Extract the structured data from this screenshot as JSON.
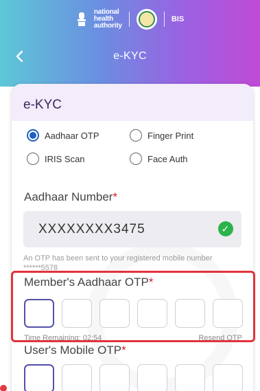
{
  "brand": {
    "nha_line1": "national",
    "nha_line2": "health",
    "nha_line3": "authority",
    "partner": "BIS"
  },
  "titlebar": {
    "title": "e-KYC",
    "back_icon": "chevron-left-icon"
  },
  "card": {
    "heading": "e-KYC",
    "options": [
      {
        "label": "Aadhaar OTP",
        "selected": true
      },
      {
        "label": "Finger Print",
        "selected": false
      },
      {
        "label": "IRIS Scan",
        "selected": false
      },
      {
        "label": "Face Auth",
        "selected": false
      }
    ],
    "aadhaar": {
      "label": "Aadhaar Number",
      "required_mark": "*",
      "value": "XXXXXXXX3475",
      "verified_icon": "check-circle-icon"
    },
    "otp_message": "An OTP has been sent to your registered mobile number ******5578",
    "member_otp": {
      "label": "Member's Aadhaar OTP",
      "required_mark": "*",
      "time_remaining": "Time Remaining: 02:54",
      "resend": "Resend OTP"
    },
    "user_otp": {
      "label": "User's Mobile OTP",
      "required_mark": "*"
    }
  },
  "colors": {
    "accent": "#1f5fbf",
    "highlight": "#e2323c",
    "success": "#2bb34a"
  }
}
